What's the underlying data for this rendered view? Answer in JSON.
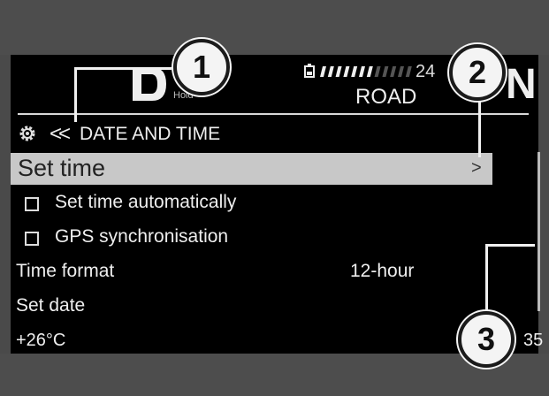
{
  "header": {
    "gear_logo_letter": "D",
    "gear_logo_sub": "Hold",
    "range": "24",
    "ride_mode": "ROAD",
    "gear_indicator": "N",
    "fuel_bar_fraction": 0.62
  },
  "menu": {
    "back_chevrons": "<<",
    "title": "DATE AND TIME",
    "items": [
      {
        "label": "Set time",
        "selected": true,
        "chevron": ">"
      },
      {
        "label": "Set time automatically",
        "checkbox": true,
        "checked": false
      },
      {
        "label": "GPS synchronisation",
        "checkbox": true,
        "checked": false
      },
      {
        "label": "Time format",
        "value": "12-hour"
      },
      {
        "label": "Set date"
      }
    ]
  },
  "footer": {
    "temperature": "+26°C",
    "clock_partial": "35"
  },
  "callouts": [
    "1",
    "2",
    "3"
  ],
  "icons": [
    "battery-icon",
    "settings-gear-icon"
  ]
}
